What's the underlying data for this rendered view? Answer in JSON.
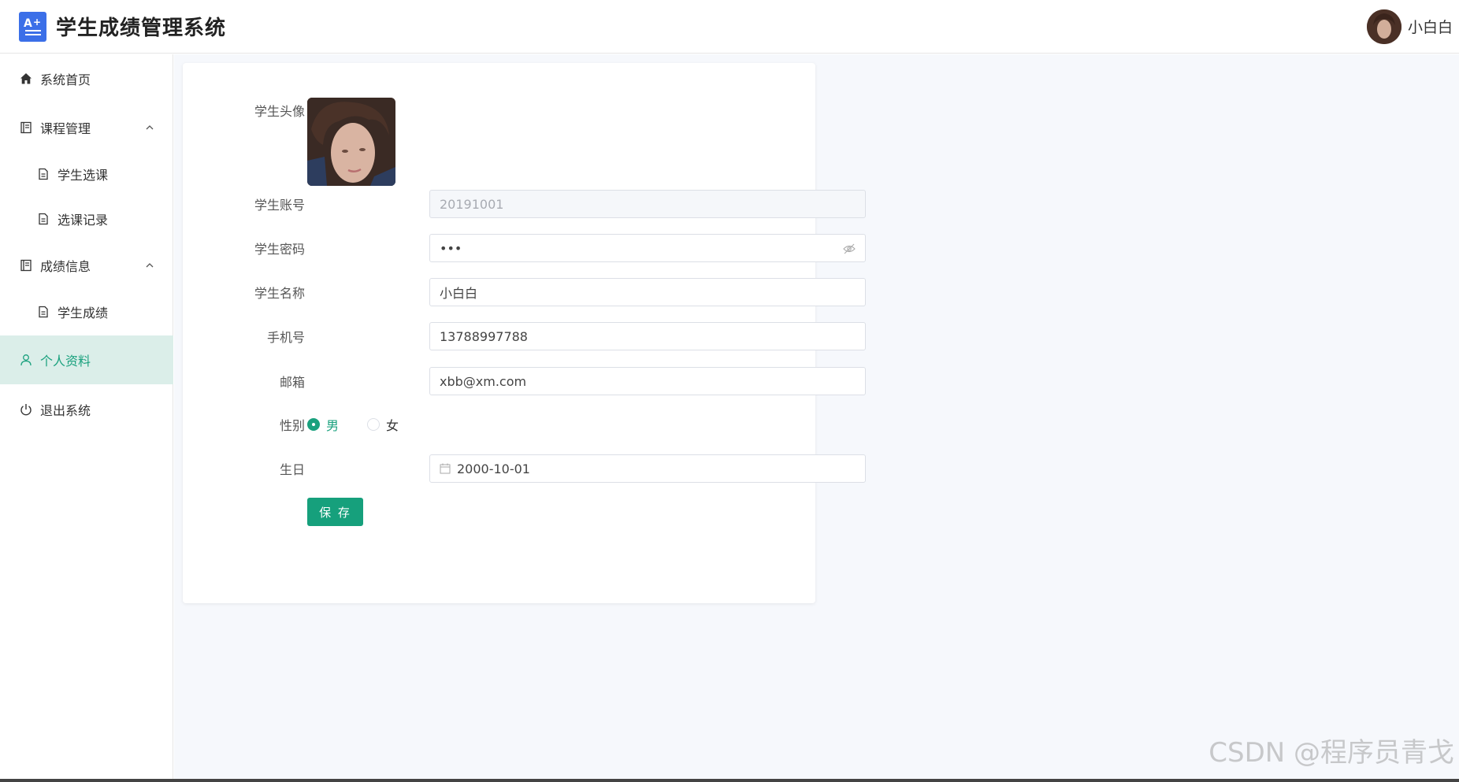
{
  "header": {
    "title": "学生成绩管理系统",
    "logo_icon": "grade-a-plus-icon",
    "user_name": "小白白"
  },
  "sidebar": {
    "items": [
      {
        "label": "系统首页",
        "icon": "home-icon"
      },
      {
        "label": "课程管理",
        "icon": "book-icon",
        "expanded": true
      },
      {
        "label": "学生选课",
        "icon": "document-icon"
      },
      {
        "label": "选课记录",
        "icon": "document-icon"
      },
      {
        "label": "成绩信息",
        "icon": "book-icon",
        "expanded": true
      },
      {
        "label": "学生成绩",
        "icon": "document-icon"
      },
      {
        "label": "个人资料",
        "icon": "user-icon",
        "active": true
      },
      {
        "label": "退出系统",
        "icon": "power-icon"
      }
    ]
  },
  "form": {
    "avatar_label": "学生头像",
    "account_label": "学生账号",
    "account_value": "20191001",
    "password_label": "学生密码",
    "password_value": "•••",
    "name_label": "学生名称",
    "name_value": "小白白",
    "phone_label": "手机号",
    "phone_value": "13788997788",
    "email_label": "邮箱",
    "email_value": "xbb@xm.com",
    "gender_label": "性别",
    "gender_options": [
      "男",
      "女"
    ],
    "gender_selected": "男",
    "birthday_label": "生日",
    "birthday_value": "2000-10-01",
    "save_label": "保 存"
  },
  "watermark": "CSDN @程序员青戈",
  "colors": {
    "accent": "#16a07c",
    "active_bg": "#dbeee9",
    "logo": "#3b6fe8"
  }
}
